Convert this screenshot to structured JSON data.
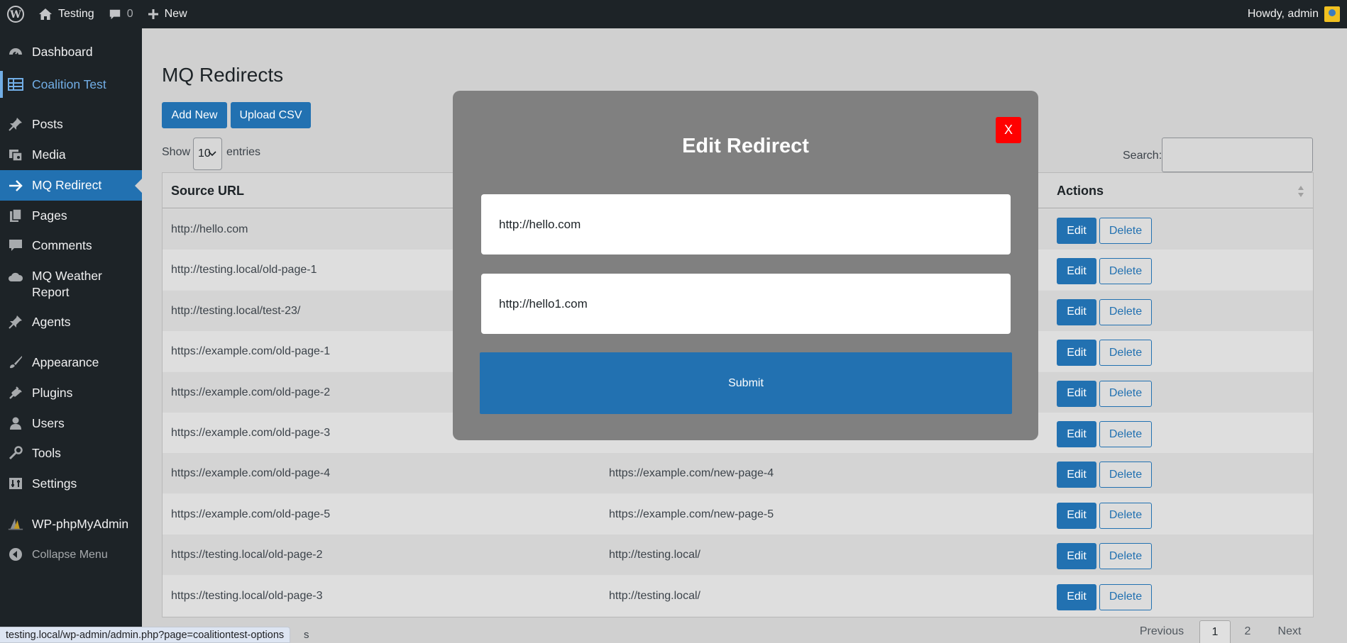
{
  "admin_bar": {
    "site_name": "Testing",
    "comments_count": "0",
    "new_label": "New",
    "howdy": "Howdy, admin"
  },
  "sidebar": {
    "items": [
      {
        "label": "Dashboard",
        "icon": "dashboard-icon"
      },
      {
        "label": "Coalition Test",
        "icon": "table-icon"
      },
      {
        "label": "Posts",
        "icon": "pin-icon"
      },
      {
        "label": "Media",
        "icon": "media-icon"
      },
      {
        "label": "MQ Redirect",
        "icon": "arrow-right-icon"
      },
      {
        "label": "Pages",
        "icon": "pages-icon"
      },
      {
        "label": "Comments",
        "icon": "comment-icon"
      },
      {
        "label": "MQ Weather Report",
        "icon": "cloud-icon"
      },
      {
        "label": "Agents",
        "icon": "pin-icon"
      },
      {
        "label": "Appearance",
        "icon": "brush-icon"
      },
      {
        "label": "Plugins",
        "icon": "plugin-icon"
      },
      {
        "label": "Users",
        "icon": "user-icon"
      },
      {
        "label": "Tools",
        "icon": "wrench-icon"
      },
      {
        "label": "Settings",
        "icon": "settings-icon"
      },
      {
        "label": "WP-phpMyAdmin",
        "icon": "phpmyadmin-icon"
      },
      {
        "label": "Collapse Menu",
        "icon": "collapse-icon"
      }
    ]
  },
  "page": {
    "title": "MQ Redirects",
    "add_new": "Add New",
    "upload_csv": "Upload CSV",
    "show_label": "Show",
    "entries_value": "10",
    "entries_label": "entries",
    "search_label": "Search:"
  },
  "table": {
    "headers": {
      "source": "Source URL",
      "actions": "Actions"
    },
    "edit_label": "Edit",
    "delete_label": "Delete",
    "rows": [
      {
        "source": "http://hello.com",
        "target": ""
      },
      {
        "source": "http://testing.local/old-page-1",
        "target": ""
      },
      {
        "source": "http://testing.local/test-23/",
        "target": ""
      },
      {
        "source": "https://example.com/old-page-1",
        "target": ""
      },
      {
        "source": "https://example.com/old-page-2",
        "target": ""
      },
      {
        "source": "https://example.com/old-page-3",
        "target": ""
      },
      {
        "source": "https://example.com/old-page-4",
        "target": "https://example.com/new-page-4"
      },
      {
        "source": "https://example.com/old-page-5",
        "target": "https://example.com/new-page-5"
      },
      {
        "source": "https://testing.local/old-page-2",
        "target": "http://testing.local/"
      },
      {
        "source": "https://testing.local/old-page-3",
        "target": "http://testing.local/"
      }
    ]
  },
  "pagination": {
    "previous": "Previous",
    "pages": [
      "1",
      "2"
    ],
    "next": "Next"
  },
  "status_bar": {
    "url": "testing.local/wp-admin/admin.php?page=coalitiontest-options",
    "tail": "s"
  },
  "modal": {
    "title": "Edit Redirect",
    "close_label": "X",
    "source_value": "http://hello.com",
    "target_value": "http://hello1.com",
    "submit_label": "Submit"
  }
}
